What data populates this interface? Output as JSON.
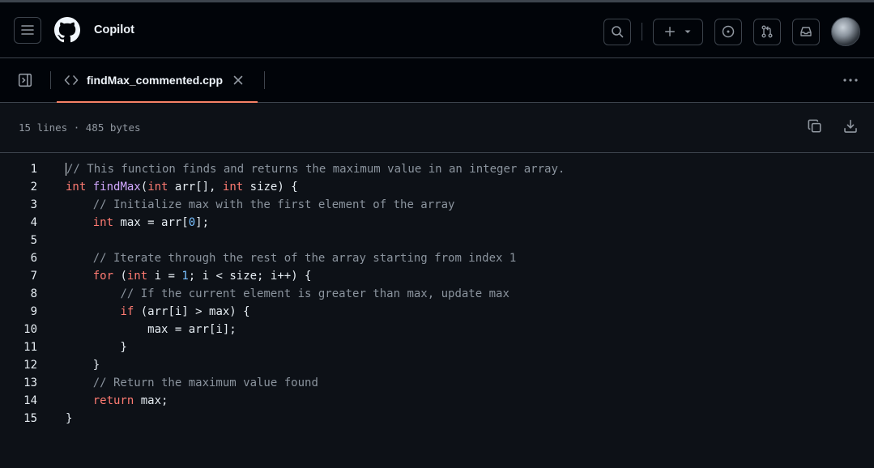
{
  "header": {
    "app_title": "Copilot",
    "icons": [
      "hamburger-menu-icon",
      "github-logo",
      "search-icon",
      "plus-icon",
      "chevron-down-icon",
      "issue-opened-icon",
      "pull-request-icon",
      "inbox-icon",
      "avatar"
    ]
  },
  "tabbar": {
    "tab_label": "findMax_commented.cpp",
    "icons": [
      "sidebar-expand-icon",
      "code-icon",
      "close-icon",
      "kebab-horizontal-icon"
    ]
  },
  "file_info": {
    "meta": "15 lines · 485 bytes",
    "icons": [
      "copy-icon",
      "download-icon"
    ]
  },
  "code": {
    "line_numbers": [
      "1",
      "2",
      "3",
      "4",
      "5",
      "6",
      "7",
      "8",
      "9",
      "10",
      "11",
      "12",
      "13",
      "14",
      "15"
    ],
    "lines": [
      "// This function finds and returns the maximum value in an integer array.",
      "int findMax(int arr[], int size) {",
      "    // Initialize max with the first element of the array",
      "    int max = arr[0];",
      "",
      "    // Iterate through the rest of the array starting from index 1",
      "    for (int i = 1; i < size; i++) {",
      "        // If the current element is greater than max, update max",
      "        if (arr[i] > max) {",
      "            max = arr[i];",
      "        }",
      "    }",
      "    // Return the maximum value found",
      "    return max;",
      "}"
    ]
  },
  "colors": {
    "background": "#0d1117",
    "header_background": "#010409",
    "border": "#3d444d",
    "tab_underline": "#f78166",
    "keyword": "#ff7b72",
    "function": "#d2a8ff",
    "number": "#79c0ff",
    "comment": "#8b949e"
  }
}
